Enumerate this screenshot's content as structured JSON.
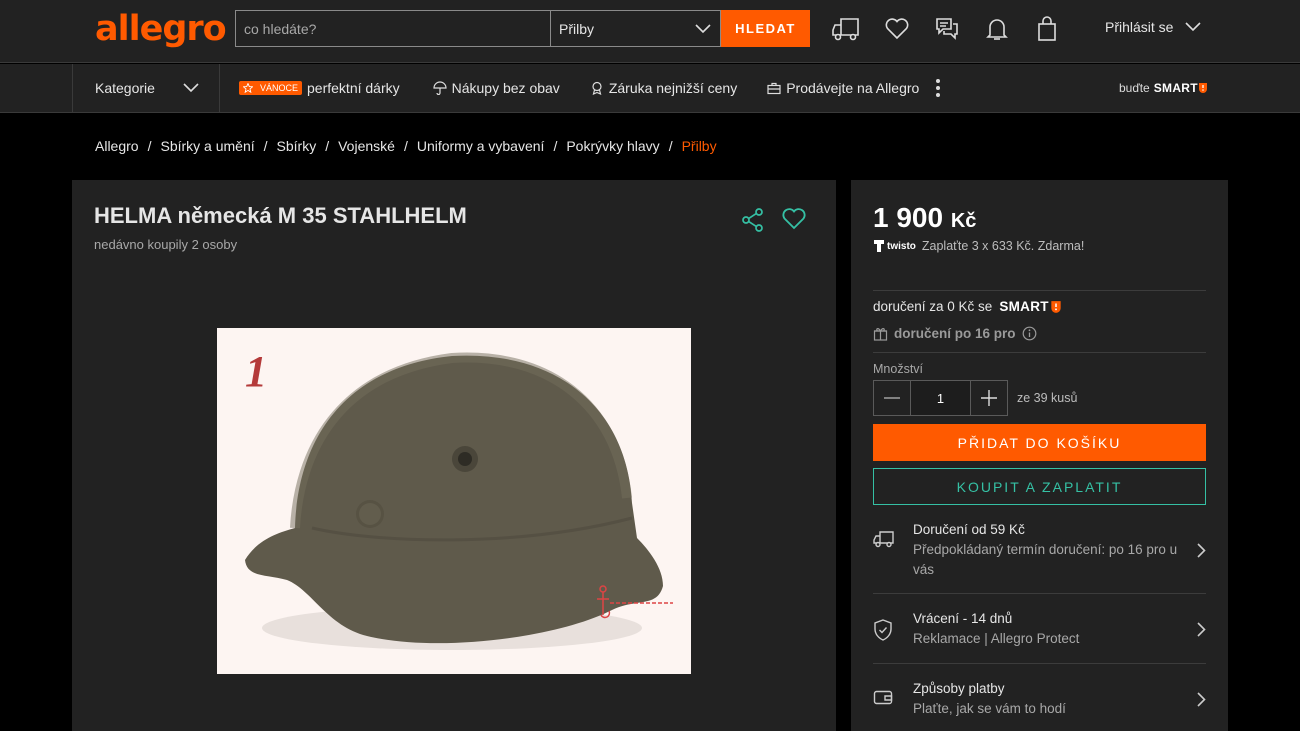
{
  "header": {
    "logo": "allegro",
    "search_placeholder": "co hledáte?",
    "search_category": "Přilby",
    "search_button": "HLEDAT",
    "login_label": "Přihlásit se",
    "icons": [
      "truck-icon",
      "heart-icon",
      "chat-icon",
      "bell-icon",
      "bag-icon"
    ]
  },
  "nav": {
    "categories_label": "Kategorie",
    "badge": "VÁNOCE",
    "links": [
      "perfektní dárky",
      "Nákupy bez obav",
      "Záruka nejnižší ceny",
      "Prodávejte na Allegro"
    ],
    "smart_prefix": "buďte",
    "smart_word": "SMART"
  },
  "breadcrumbs": [
    "Allegro",
    "Sbírky a umění",
    "Sbírky",
    "Vojenské",
    "Uniformy a vybavení",
    "Pokrývky hlavy",
    "Přilby"
  ],
  "product": {
    "title": "HELMA německá M 35 STAHLHELM",
    "subtitle": "nedávno koupily 2 osoby",
    "photo_number": "1"
  },
  "purchase": {
    "price_number": "1 900",
    "price_currency": "Kč",
    "twisto_label": "twisto",
    "twisto_text": "Zaplaťte 3 x 633 Kč. Zdarma!",
    "delivery_smart_text": "doručení za 0 Kč se",
    "smart_word": "SMART",
    "delivery_days": "doručení po 16 pro",
    "qty_label": "Množství",
    "qty_value": "1",
    "qty_note": "ze 39 kusů",
    "cart_button": "PŘIDAT DO KOŠÍKU",
    "buy_button": "KOUPIT A ZAPLATIT"
  },
  "info_rows": [
    {
      "title": "Doručení od 59 Kč",
      "desc": "Předpokládaný termín doručení: po 16 pro u vás",
      "icon": "truck-icon"
    },
    {
      "title": "Vrácení - 14 dnů",
      "desc": "Reklamace | Allegro Protect",
      "icon": "shield-icon"
    },
    {
      "title": "Způsoby platby",
      "desc": "Plaťte, jak se vám to hodí",
      "icon": "wallet-icon"
    }
  ],
  "colors": {
    "accent": "#ff5a00",
    "teal": "#35c0a4",
    "panel": "#222222",
    "background": "#000000"
  }
}
